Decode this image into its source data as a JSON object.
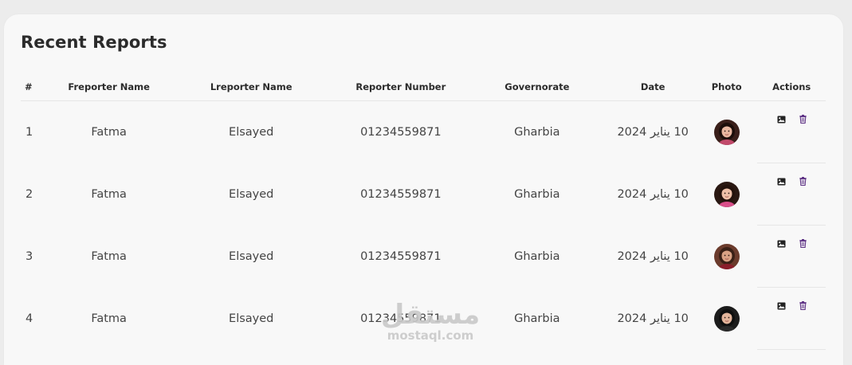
{
  "card": {
    "title": "Recent Reports"
  },
  "table": {
    "headers": {
      "num": "#",
      "first_name": "Freporter Name",
      "last_name": "Lreporter Name",
      "number": "Reporter Number",
      "governorate": "Governorate",
      "date": "Date",
      "photo": "Photo",
      "actions": "Actions"
    },
    "rows": [
      {
        "num": "1",
        "first_name": "Fatma",
        "last_name": "Elsayed",
        "number": "01234559871",
        "governorate": "Gharbia",
        "date": "10 يناير 2024",
        "photo": "avatar-girl-1"
      },
      {
        "num": "2",
        "first_name": "Fatma",
        "last_name": "Elsayed",
        "number": "01234559871",
        "governorate": "Gharbia",
        "date": "10 يناير 2024",
        "photo": "avatar-girl-2"
      },
      {
        "num": "3",
        "first_name": "Fatma",
        "last_name": "Elsayed",
        "number": "01234559871",
        "governorate": "Gharbia",
        "date": "10 يناير 2024",
        "photo": "avatar-girl-3"
      },
      {
        "num": "4",
        "first_name": "Fatma",
        "last_name": "Elsayed",
        "number": "01234559871",
        "governorate": "Gharbia",
        "date": "10 يناير 2024",
        "photo": "avatar-girl-4"
      }
    ],
    "row_actions": [
      "image-icon",
      "trash-icon"
    ]
  },
  "watermark": {
    "arabic": "مستقل",
    "latin": "mostaql.com"
  },
  "colors": {
    "page_bg": "#ececec",
    "card_bg": "#f8f8f8",
    "title": "#2b2b2b",
    "text": "#444444",
    "trash_icon": "#5a2d82",
    "image_icon": "#222222",
    "watermark": "#c9c9c9"
  }
}
